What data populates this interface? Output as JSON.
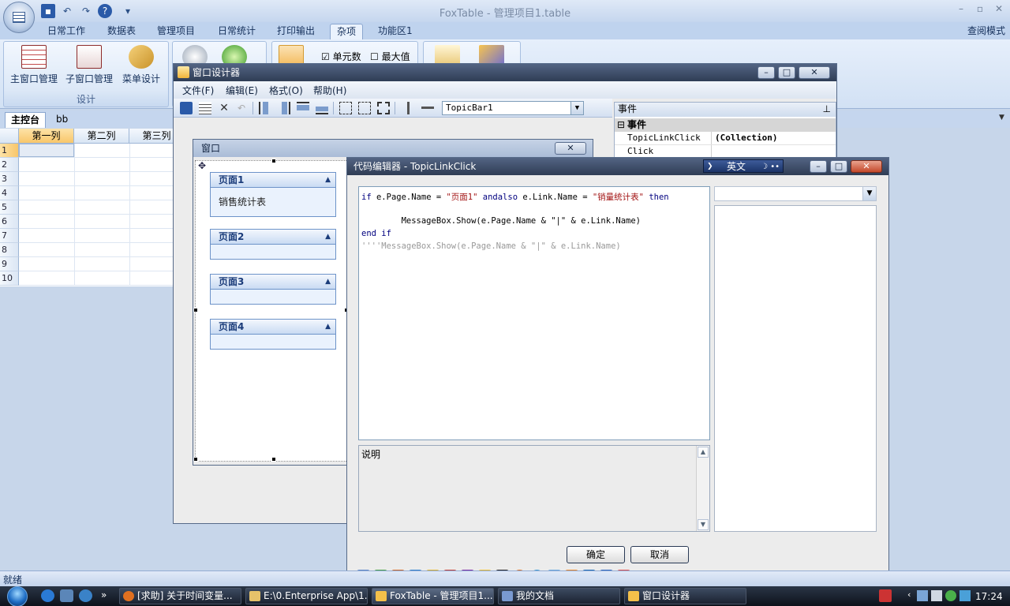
{
  "app": {
    "title": "FoxTable - 管理项目1.table",
    "read_mode": "查阅模式",
    "status": "就绪"
  },
  "ribbon": {
    "tabs": [
      "日常工作",
      "数据表",
      "管理项目",
      "日常统计",
      "打印输出",
      "杂项",
      "功能区1"
    ],
    "active_tab": "杂项",
    "group_design": {
      "label": "设计",
      "buttons": [
        "主窗口管理",
        "子窗口管理",
        "菜单设计"
      ]
    },
    "checkbox_cells": "单元数",
    "checkbox_max": "最大值"
  },
  "sheet": {
    "tabs": [
      "主控台",
      "bb"
    ],
    "columns": [
      "第一列",
      "第二列",
      "第三列"
    ],
    "rows": [
      "1",
      "2",
      "3",
      "4",
      "5",
      "6",
      "7",
      "8",
      "9",
      "10"
    ]
  },
  "designer": {
    "title": "窗口设计器",
    "menus": [
      "文件(F)",
      "编辑(E)",
      "格式(O)",
      "帮助(H)"
    ],
    "component_combo": "TopicBar1",
    "props": {
      "header": "事件",
      "category": "事件",
      "rows": [
        {
          "key": "TopicLinkClick",
          "value": "(Collection)"
        },
        {
          "key": "Click",
          "value": ""
        }
      ]
    }
  },
  "form": {
    "title": "窗口",
    "pages": [
      {
        "title": "页面1",
        "link": "销售统计表"
      },
      {
        "title": "页面2",
        "link": ""
      },
      {
        "title": "页面3",
        "link": ""
      },
      {
        "title": "页面4",
        "link": ""
      }
    ]
  },
  "code_editor": {
    "title": "代码编辑器 - TopicLinkClick",
    "ime_label": "英文",
    "code_lines": [
      {
        "kw1": "if",
        "t1": " e.Page.Name = ",
        "s1": "\"页面1\"",
        "kw2": " andalso",
        "t2": " e.Link.Name = ",
        "s2": "\"销量统计表\"",
        "kw3": " then"
      },
      {
        "plain": "        MessageBox.Show(e.Page.Name & \"|\" & e.Link.Name)"
      },
      {
        "plain": "end if"
      },
      {
        "comment": "''''MessageBox.Show(e.Page.Name & \"|\" & e.Link.Name)"
      }
    ],
    "description_label": "说明",
    "ok": "确定",
    "cancel": "取消"
  },
  "taskbar": {
    "tasks": [
      "[求助] 关于时间变量...",
      "E:\\0.Enterprise App\\1...",
      "FoxTable - 管理项目1...",
      "我的文档",
      "窗口设计器"
    ],
    "clock": "17:24"
  },
  "colors": {
    "ribbon_bg": "#d2e1f4",
    "pane_border": "#6d93c9",
    "code_keyword": "#00007f",
    "code_string": "#a31515",
    "code_comment": "#999999"
  }
}
